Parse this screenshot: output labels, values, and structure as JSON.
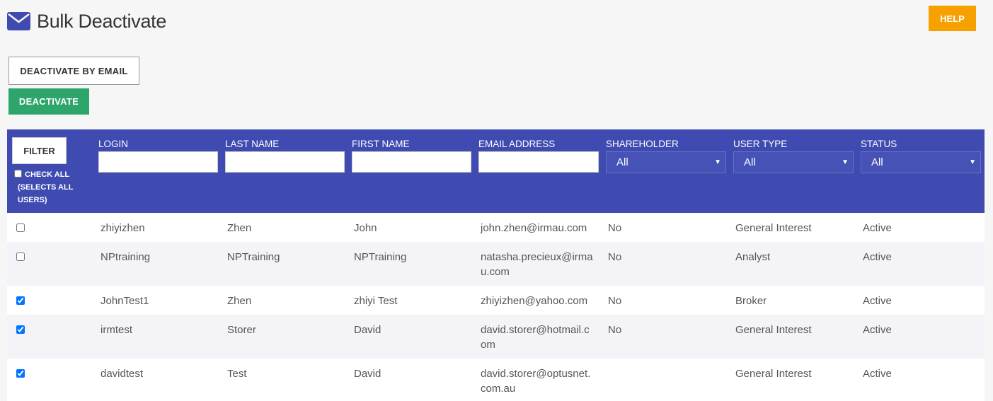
{
  "page": {
    "title": "Bulk Deactivate",
    "title_icon": "envelope-icon",
    "help_label": "HELP"
  },
  "actions": {
    "deactivate_by_email": "DEACTIVATE BY EMAIL",
    "deactivate": "DEACTIVATE"
  },
  "filters": {
    "filter_label": "FILTER",
    "check_all_line1": "CHECK ALL",
    "check_all_line2": "(SELECTS ALL",
    "check_all_line3": "USERS)",
    "login": {
      "label": "LOGIN",
      "value": ""
    },
    "last_name": {
      "label": "LAST NAME",
      "value": ""
    },
    "first_name": {
      "label": "FIRST NAME",
      "value": ""
    },
    "email": {
      "label": "EMAIL ADDRESS",
      "value": ""
    },
    "shareholder": {
      "label": "SHAREHOLDER",
      "value": "All"
    },
    "user_type": {
      "label": "USER TYPE",
      "value": "All"
    },
    "status": {
      "label": "STATUS",
      "value": "All"
    }
  },
  "rows": [
    {
      "checked": false,
      "login": "zhiyizhen",
      "last_name": "Zhen",
      "first_name": "John",
      "email_l1": "john.zhen@irmau.com",
      "email_l2": "",
      "shareholder": "No",
      "user_type": "General Interest",
      "status": "Active"
    },
    {
      "checked": false,
      "login": "NPtraining",
      "last_name": "NPTraining",
      "first_name": "NPTraining",
      "email_l1": "natasha.precieux@irma",
      "email_l2": "u.com",
      "shareholder": "No",
      "user_type": "Analyst",
      "status": "Active"
    },
    {
      "checked": true,
      "login": "JohnTest1",
      "last_name": "Zhen",
      "first_name": "zhiyi Test",
      "email_l1": "zhiyizhen@yahoo.com",
      "email_l2": "",
      "shareholder": "No",
      "user_type": "Broker",
      "status": "Active"
    },
    {
      "checked": true,
      "login": "irmtest",
      "last_name": "Storer",
      "first_name": "David",
      "email_l1": "david.storer@hotmail.c",
      "email_l2": "om",
      "shareholder": "No",
      "user_type": "General Interest",
      "status": "Active"
    },
    {
      "checked": true,
      "login": "davidtest",
      "last_name": "Test",
      "first_name": "David",
      "email_l1": "david.storer@optusnet.",
      "email_l2": "com.au",
      "shareholder": "",
      "user_type": "General Interest",
      "status": "Active"
    }
  ]
}
